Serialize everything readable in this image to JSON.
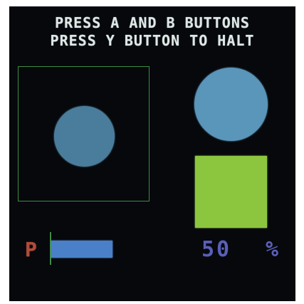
{
  "instructions": {
    "line1": "PRESS A AND B BUTTONS",
    "line2": "PRESS Y BUTTON TO HALT"
  },
  "status": {
    "label": "P",
    "percent_value": "50",
    "percent_sign": "%",
    "level_fraction": 0.5
  },
  "colors": {
    "background": "#06080c",
    "text": "#dfe8e6",
    "play_area_border": "#3f8c43",
    "moving_circle": "#4a7d9b",
    "indicator_circle": "#5a95ba",
    "indicator_square": "#8cc63f",
    "label": "#b24a3a",
    "bar": "#4a80c8",
    "percent": "#5a5fb8"
  },
  "icons": {
    "moving": "circle",
    "indicator_top": "circle",
    "indicator_bottom": "square"
  }
}
